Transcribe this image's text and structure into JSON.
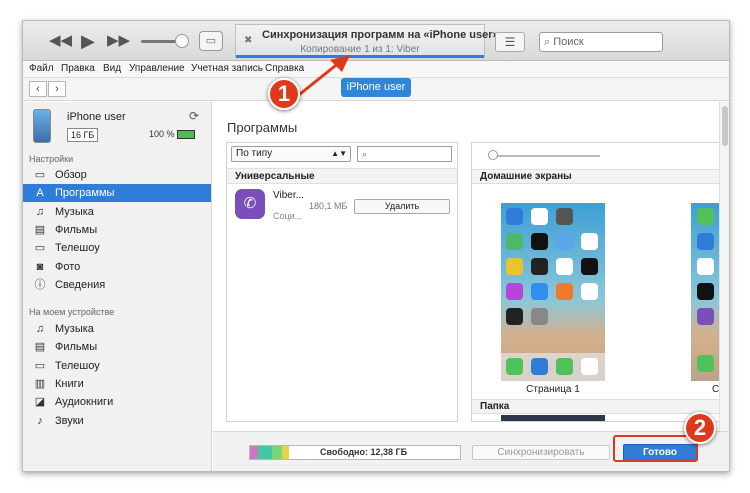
{
  "toolbar": {
    "rewind_icon": "rewind-icon",
    "play_icon": "play-icon",
    "forward_icon": "fast-forward-icon",
    "lcd_title": "Синхронизация программ на «iPhone user»...",
    "lcd_subtitle": "Копирование 1 из 1: Viber",
    "search_placeholder": "Поиск"
  },
  "menu": [
    "Файл",
    "Правка",
    "Вид",
    "Управление",
    "Учетная запись",
    "Справка"
  ],
  "device_button": "iPhone user",
  "device": {
    "name": "iPhone user",
    "capacity": "16 ГБ",
    "battery": "100 %"
  },
  "sidebar": {
    "settings_title": "Настройки",
    "settings_items": [
      {
        "label": "Обзор",
        "icon": "overview-icon"
      },
      {
        "label": "Программы",
        "icon": "apps-icon"
      },
      {
        "label": "Музыка",
        "icon": "music-icon"
      },
      {
        "label": "Фильмы",
        "icon": "film-icon"
      },
      {
        "label": "Телешоу",
        "icon": "tv-icon"
      },
      {
        "label": "Фото",
        "icon": "camera-icon"
      },
      {
        "label": "Сведения",
        "icon": "info-icon"
      }
    ],
    "device_title": "На моем устройстве",
    "device_items": [
      {
        "label": "Музыка",
        "icon": "music-icon"
      },
      {
        "label": "Фильмы",
        "icon": "film-icon"
      },
      {
        "label": "Телешоу",
        "icon": "tv-icon"
      },
      {
        "label": "Книги",
        "icon": "book-icon"
      },
      {
        "label": "Аудиокниги",
        "icon": "audiobook-icon"
      },
      {
        "label": "Звуки",
        "icon": "bell-icon"
      }
    ],
    "active": "Программы"
  },
  "main": {
    "title": "Программы",
    "sort_label": "По типу",
    "group_label": "Универсальные",
    "app": {
      "name": "Viber...",
      "size": "180,1 МБ",
      "category": "Соци...",
      "delete_label": "Удалить"
    },
    "home_screens_label": "Домашние экраны",
    "page_label": "Страница 1",
    "page_label_2": "С",
    "folder_label": "Папка"
  },
  "bottom": {
    "free_label": "Свободно: 12,38 ГБ",
    "sync_label": "Синхронизировать",
    "done_label": "Готово"
  },
  "annotations": {
    "marker1": "1",
    "marker2": "2",
    "color": "#e0381b"
  },
  "colors": {
    "accent": "#2f7dd8",
    "storage_segments": [
      "#c979c4",
      "#43c7a3",
      "#7ad47a",
      "#e5d24a",
      "#d8d8d8"
    ]
  }
}
